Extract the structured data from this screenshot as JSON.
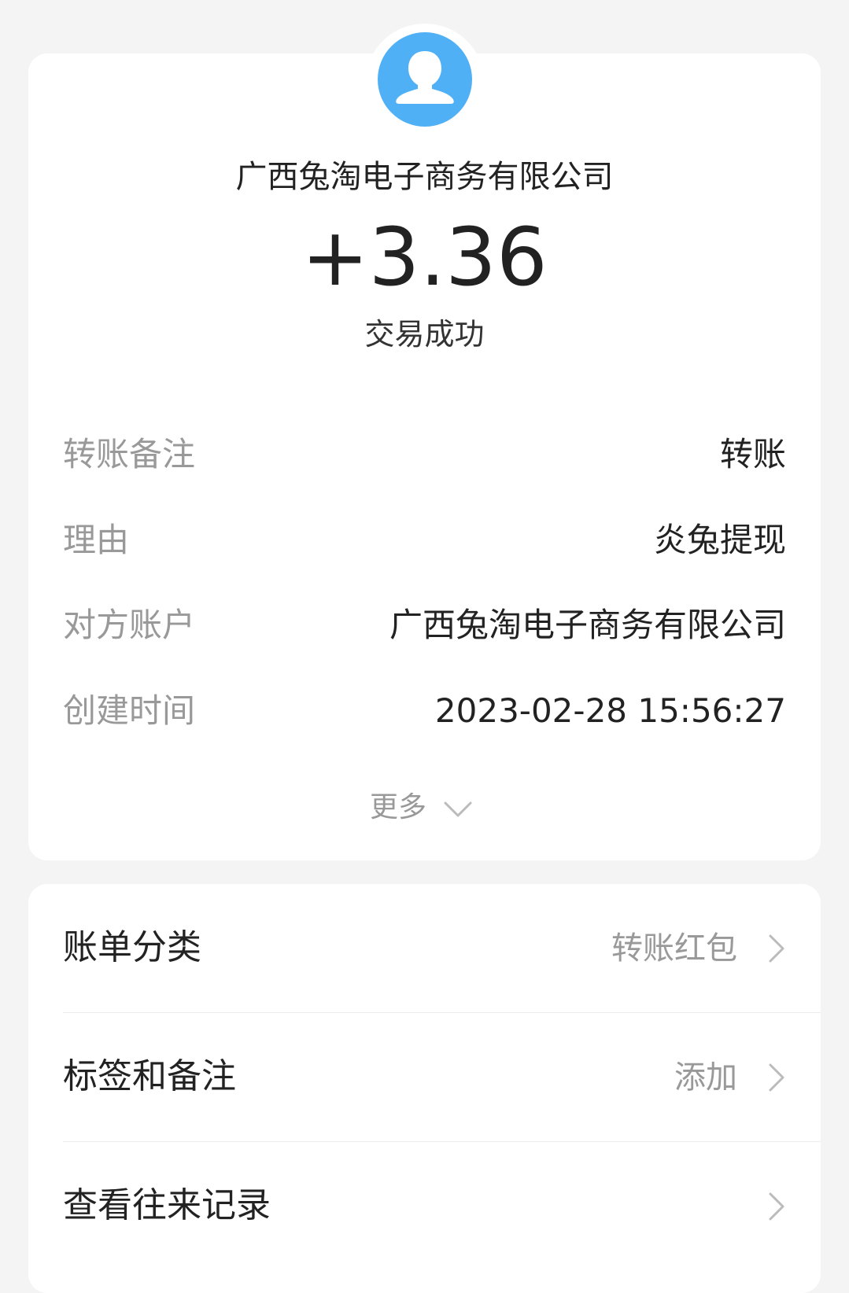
{
  "header": {
    "avatar_icon": "user-avatar-icon",
    "merchant_name": "广西兔淘电子商务有限公司",
    "amount": "+3.36",
    "status": "交易成功"
  },
  "details": [
    {
      "label": "转账备注",
      "value": "转账"
    },
    {
      "label": "理由",
      "value": "炎兔提现"
    },
    {
      "label": "对方账户",
      "value": "广西兔淘电子商务有限公司"
    },
    {
      "label": "创建时间",
      "value": "2023-02-28 15:56:27"
    }
  ],
  "more": {
    "label": "更多",
    "icon": "chevron-down-icon"
  },
  "list": [
    {
      "label": "账单分类",
      "value": "转账红包",
      "icon": "chevron-right-icon"
    },
    {
      "label": "标签和备注",
      "value": "添加",
      "icon": "chevron-right-icon"
    },
    {
      "label": "查看往来记录",
      "value": "",
      "icon": "chevron-right-icon"
    }
  ],
  "colors": {
    "avatar_bg": "#4fb0f6",
    "page_bg": "#f4f4f4",
    "primary_text": "#222222",
    "secondary_text": "#999999"
  }
}
